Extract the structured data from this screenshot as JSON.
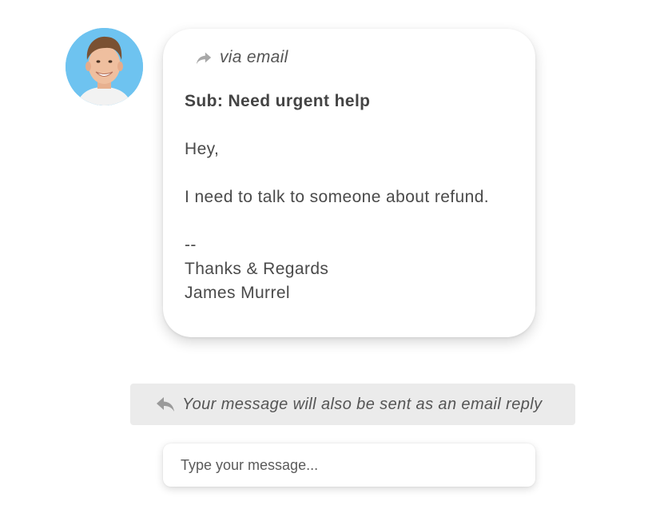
{
  "sender": {
    "avatar_icon": "person-avatar",
    "avatar_bg": "#6ec3f0"
  },
  "email": {
    "channel_icon": "forward-icon",
    "channel_label": "via email",
    "subject": "Sub: Need urgent help",
    "greeting": "Hey,",
    "message": "I need to talk to someone about refund.",
    "signature_separator": "--",
    "signature_closing": "Thanks & Regards",
    "signature_name": "James Murrel"
  },
  "reply_notice": {
    "icon": "reply-icon",
    "text": "Your message will also be sent as an email reply",
    "background": "#ebebeb"
  },
  "composer": {
    "placeholder": "Type your message..."
  }
}
